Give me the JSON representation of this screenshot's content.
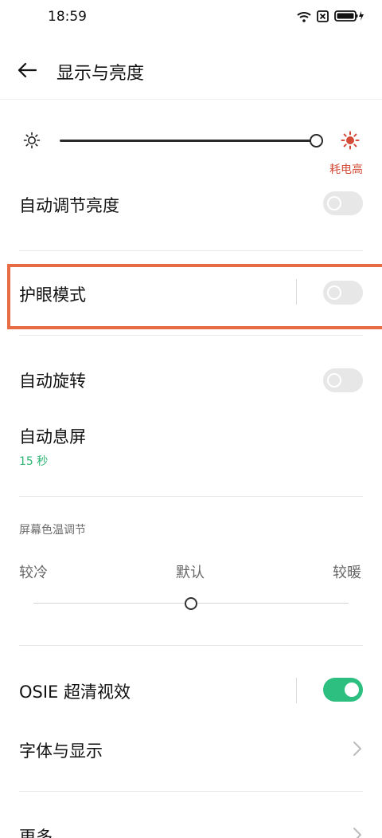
{
  "status_bar": {
    "time": "18:59",
    "icons": [
      "wifi-icon",
      "sim-blocked-icon",
      "battery-charging-icon"
    ]
  },
  "header": {
    "title": "显示与亮度",
    "back_icon": "arrow-left-icon"
  },
  "brightness": {
    "level": 1.0,
    "warning": "耗电高",
    "warning_color": "#d24b38"
  },
  "settings": {
    "auto_brightness": {
      "label": "自动调节亮度",
      "enabled": false
    },
    "eye_comfort": {
      "label": "护眼模式",
      "enabled": false,
      "highlight_color": "#e86c43"
    },
    "auto_rotate": {
      "label": "自动旋转",
      "enabled": false
    },
    "screen_timeout": {
      "label": "自动息屏",
      "value": "15 秒"
    }
  },
  "color_temp": {
    "section_title": "屏幕色温调节",
    "labels": {
      "cold": "较冷",
      "default": "默认",
      "warm": "较暖"
    },
    "level": 0.5
  },
  "osie": {
    "label": "OSIE 超清视效",
    "enabled": true,
    "accent_color": "#2dbf7f"
  },
  "font_display": {
    "label": "字体与显示"
  },
  "more": {
    "label": "更多"
  }
}
